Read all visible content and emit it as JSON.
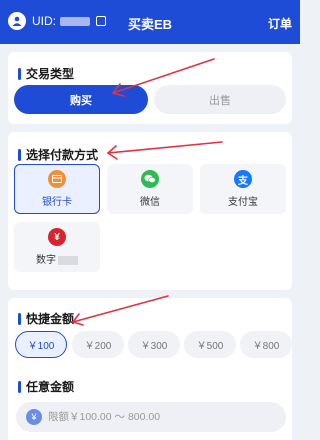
{
  "header": {
    "uid_label": "UID:",
    "title": "买卖EB",
    "orders_label": "订单"
  },
  "trade_type": {
    "title": "交易类型",
    "buy_label": "购买",
    "sell_label": "出售"
  },
  "payment": {
    "title": "选择付款方式",
    "methods": [
      {
        "label": "银行卡",
        "icon": "bank-card-icon",
        "selected": true
      },
      {
        "label": "微信",
        "icon": "wechat-icon",
        "selected": false
      },
      {
        "label": "支付宝",
        "icon": "alipay-icon",
        "selected": false
      },
      {
        "label": "数字",
        "icon": "digital-rmb-icon",
        "selected": false
      }
    ]
  },
  "quick_amount": {
    "title": "快捷金额",
    "options": [
      "￥100",
      "￥200",
      "￥300",
      "￥500",
      "￥800"
    ],
    "selected_index": 0
  },
  "custom_amount": {
    "title": "任意金额",
    "placeholder": "限额￥100.00 ～ 800.00"
  },
  "colors": {
    "primary": "#1f4cd6",
    "arrow": "#e0323f",
    "wechat": "#2dbb55",
    "alipay": "#1677ff",
    "bank": "#f0913a",
    "digital_rmb": "#d6252e"
  }
}
